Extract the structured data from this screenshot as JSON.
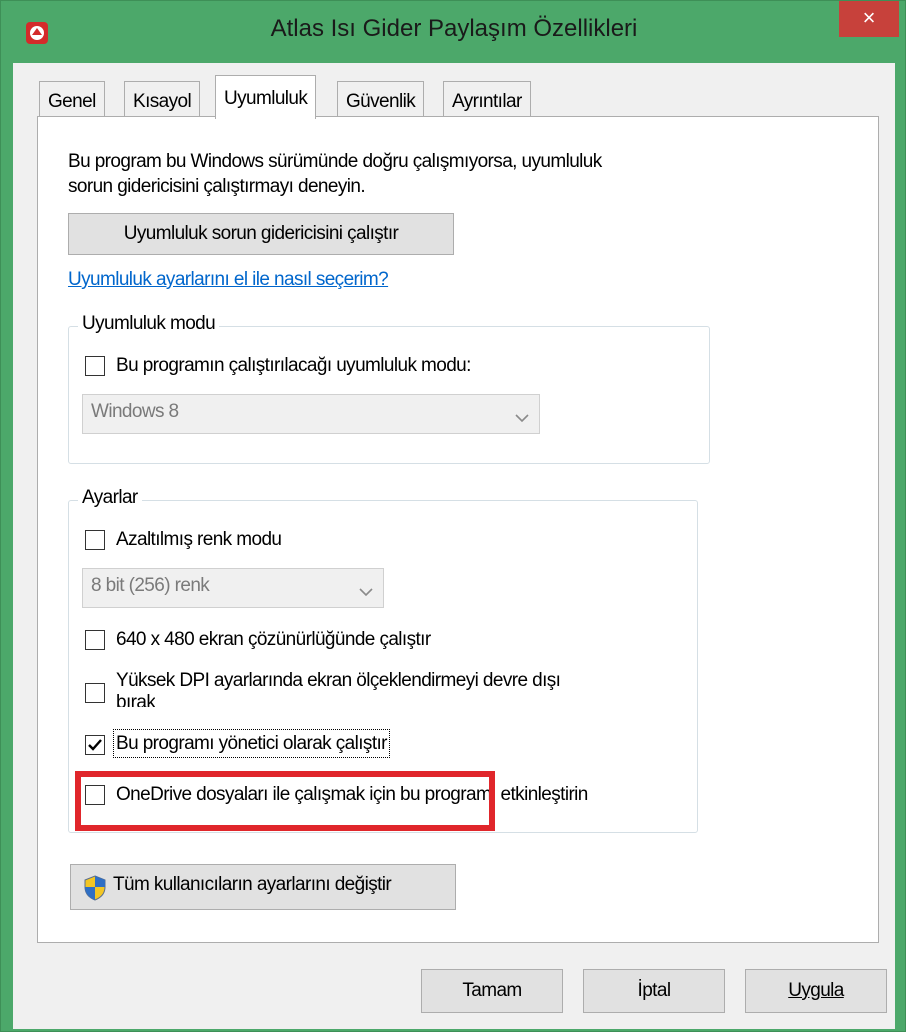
{
  "window": {
    "title": "Atlas Isı Gider Paylaşım Özellikleri",
    "close_label": "×"
  },
  "tabs": [
    {
      "label": "Genel"
    },
    {
      "label": "Kısayol"
    },
    {
      "label": "Uyumluluk"
    },
    {
      "label": "Güvenlik"
    },
    {
      "label": "Ayrıntılar"
    }
  ],
  "compat": {
    "intro_line1": "Bu program bu Windows sürümünde doğru çalışmıyorsa, uyumluluk",
    "intro_line2": "sorun gidericisini çalıştırmayı deneyin.",
    "troubleshooter_button": "Uyumluluk sorun gidericisini çalıştır",
    "manual_link": "Uyumluluk ayarlarını el ile nasıl seçerim?"
  },
  "compat_mode": {
    "legend": "Uyumluluk modu",
    "checkbox_label": "Bu programın çalıştırılacağı uyumluluk modu:",
    "checked": false,
    "os_value": "Windows 8"
  },
  "settings": {
    "legend": "Ayarlar",
    "reduced_color_label": "Azaltılmış renk modu",
    "reduced_color_checked": false,
    "color_value": "8 bit (256) renk",
    "resolution_label": "640 x 480 ekran çözünürlüğünde çalıştır",
    "resolution_checked": false,
    "dpi_label_line1": "Yüksek DPI ayarlarında ekran ölçeklendirmeyi devre dışı",
    "dpi_label_line2": "bırak",
    "dpi_checked": false,
    "admin_label": "Bu programı yönetici olarak çalıştır",
    "admin_checked": true,
    "onedrive_label": "OneDrive dosyaları ile çalışmak için bu programı etkinleştirin",
    "onedrive_checked": false
  },
  "all_users_button": "Tüm kullanıcıların ayarlarını değiştir",
  "footer": {
    "ok": "Tamam",
    "cancel": "İptal",
    "apply": "Uygula"
  },
  "colors": {
    "titlebar": "#4ca86a",
    "close": "#c7413b",
    "highlight": "#e0262b",
    "link": "#0066cc"
  }
}
